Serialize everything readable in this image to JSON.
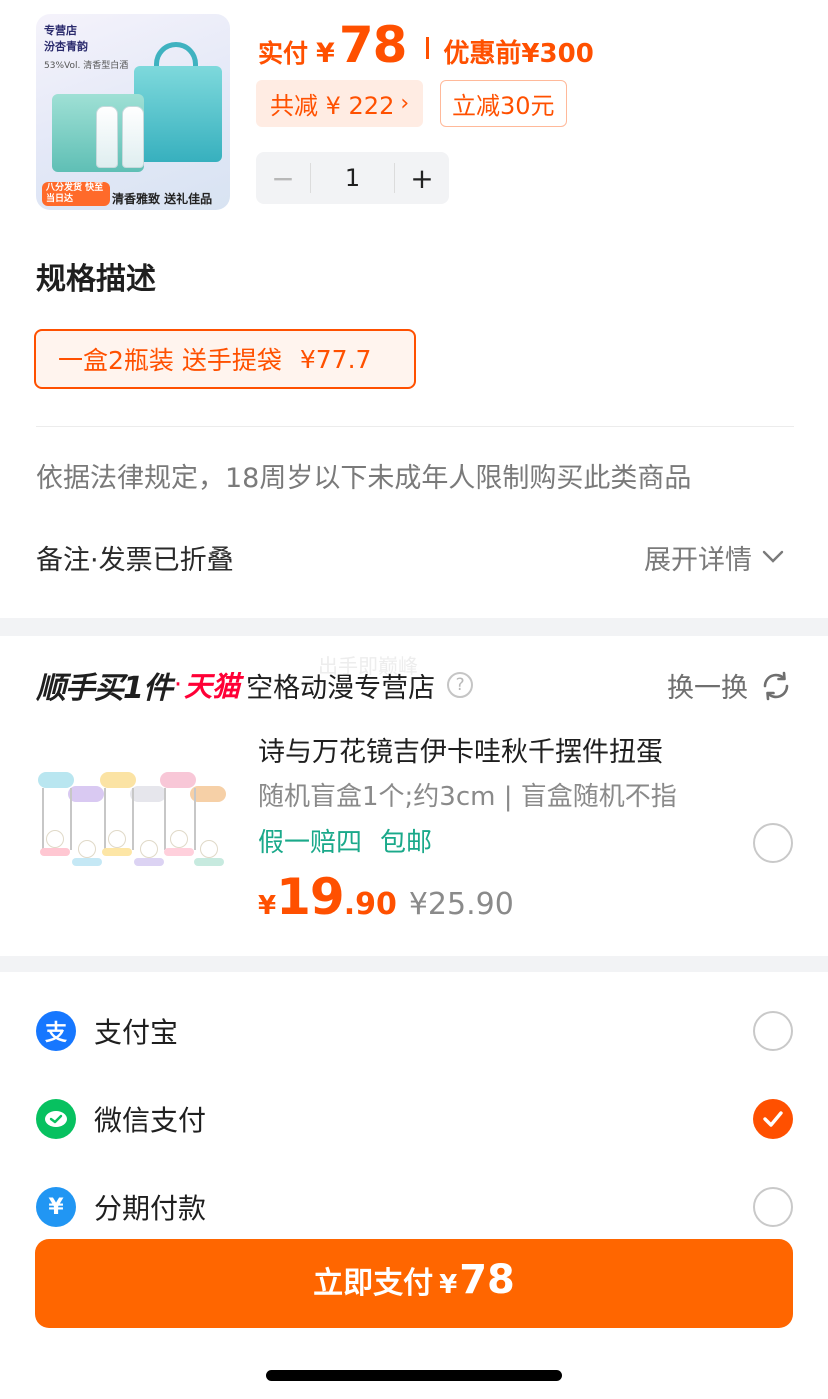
{
  "product": {
    "thumb_brand": "汾杏青韵",
    "thumb_shop": "专营店",
    "thumb_tag": "53%Vol. 清香型白酒",
    "thumb_ribbon": "八分发货 快至当日达",
    "thumb_foot": "清香雅致 送礼佳品",
    "price_label": "实付",
    "currency": "¥",
    "price": "78",
    "orig_label": "优惠前",
    "orig_price": "¥300",
    "discount_total": "共减 ¥ 222",
    "discount_instant": "立减30元",
    "quantity": "1",
    "minus": "−",
    "plus": "+"
  },
  "spec": {
    "title": "规格描述",
    "option": "一盒2瓶装 送手提袋",
    "option_price": "¥77.7"
  },
  "legal_notice": "依据法律规定，18周岁以下未成年人限制购买此类商品",
  "note": {
    "label": "备注·发票已折叠",
    "expand": "展开详情"
  },
  "recommend": {
    "heading": "顺手买1件",
    "dot": "·",
    "platform": "天猫",
    "shop": "空格动漫专营店",
    "help": "?",
    "swap": "换一换",
    "watermark": "出手即巅峰",
    "item_name": "诗与万花镜吉伊卡哇秋千摆件扭蛋",
    "item_spec": "随机盲盒1个;约3cm | 盲盒随机不指",
    "tags": [
      "假一赔四",
      "包邮"
    ],
    "currency": "¥",
    "price_int": "19",
    "price_dec": ".90",
    "orig_price": "¥25.90",
    "selected": false
  },
  "payment": {
    "methods": [
      {
        "label": "支付宝",
        "icon": "alipay-icon",
        "color": "#1677ff",
        "glyph": "支",
        "selected": false
      },
      {
        "label": "微信支付",
        "icon": "wechat-icon",
        "color": "#07c160",
        "glyph": "✓",
        "selected": true
      },
      {
        "label": "分期付款",
        "icon": "installment-icon",
        "color": "#2196f3",
        "glyph": "¥",
        "selected": false
      }
    ],
    "button_label": "立即支付",
    "button_currency": "¥",
    "button_amount": "78"
  },
  "colors": {
    "accent": "#ff5000",
    "pay_button": "#ff6600",
    "tag_green": "#1aa98a",
    "tmall_red": "#ff0036"
  }
}
